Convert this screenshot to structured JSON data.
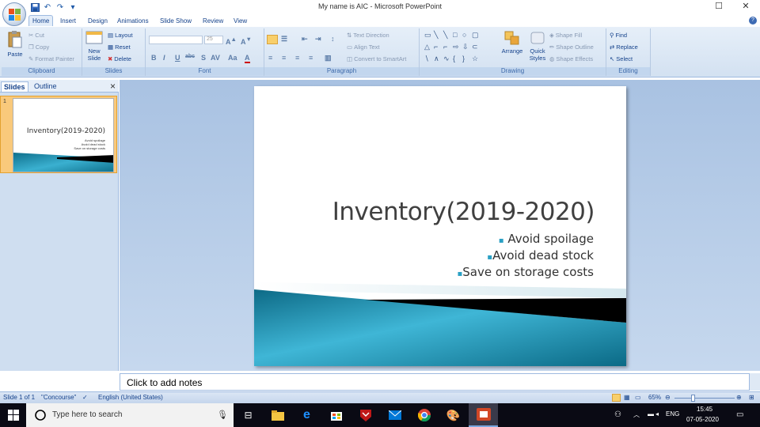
{
  "window": {
    "title": "My name is AIC - Microsoft PowerPoint",
    "minimize": "—",
    "restore": "☐",
    "close": "✕"
  },
  "qat": {
    "save": "save-icon",
    "undo": "↶",
    "redo": "↷",
    "dropdown": "▾"
  },
  "tabs": [
    "Home",
    "Insert",
    "Design",
    "Animations",
    "Slide Show",
    "Review",
    "View"
  ],
  "help": "?",
  "ribbon": {
    "clipboard": {
      "label": "Clipboard",
      "paste": "Paste",
      "cut": "Cut",
      "copy": "Copy",
      "format_painter": "Format Painter"
    },
    "slides": {
      "label": "Slides",
      "new_slide": "New Slide",
      "layout": "Layout",
      "reset": "Reset",
      "delete": "Delete"
    },
    "font": {
      "label": "Font",
      "font_size": "25"
    },
    "paragraph": {
      "label": "Paragraph",
      "text_direction": "Text Direction",
      "align_text": "Align Text",
      "convert_smartart": "Convert to SmartArt"
    },
    "drawing": {
      "label": "Drawing",
      "arrange": "Arrange",
      "quick_styles": "Quick Styles",
      "shape_fill": "Shape Fill",
      "shape_outline": "Shape Outline",
      "shape_effects": "Shape Effects"
    },
    "editing": {
      "label": "Editing",
      "find": "Find",
      "replace": "Replace",
      "select": "Select"
    }
  },
  "left_pane": {
    "tab_slides": "Slides",
    "tab_outline": "Outline",
    "close": "×",
    "slide_number": "1"
  },
  "slide": {
    "title": "Inventory(2019-2020)",
    "bullets": [
      "Avoid spoilage",
      "Avoid dead stock",
      "Save on storage costs"
    ],
    "bullet_marker": "▪"
  },
  "notes": {
    "placeholder": "Click to add notes"
  },
  "status": {
    "slide_of": "Slide 1 of 1",
    "theme": "\"Concourse\"",
    "language": "English (United States)",
    "zoom": "65%"
  },
  "taskbar": {
    "search_placeholder": "Type here to search",
    "language": "ENG",
    "time": "15:45",
    "date": "07-05-2020"
  },
  "colors": {
    "accent_teal": "#1b8fb0",
    "ribbon_blue": "#15428b"
  }
}
